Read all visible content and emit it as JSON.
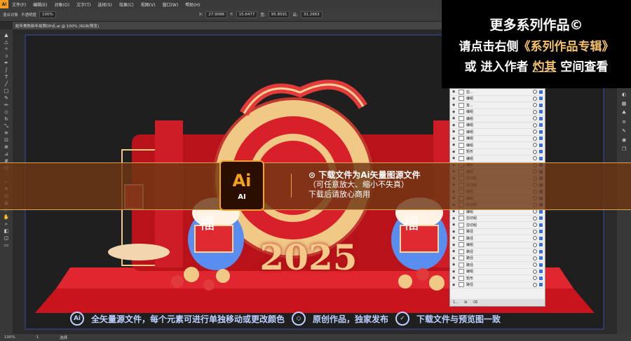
{
  "menubar": {
    "app_logo": "Ai",
    "items": [
      "文件(F)",
      "编辑(E)",
      "对象(O)",
      "文字(T)",
      "选择(S)",
      "效果(C)",
      "视图(V)",
      "窗口(W)",
      "帮助(H)"
    ]
  },
  "ctrlbar": {
    "selection": "混合对象",
    "opacity_label": "不透明度",
    "opacity_value": "100%",
    "x_label": "X:",
    "x_value": "27.9086",
    "y_label": "Y:",
    "y_value": "15.6477",
    "w_label": "宽:",
    "w_value": "95.8591",
    "h_label": "高:",
    "h_value": "31.2963"
  },
  "tab": {
    "title": "蛇年美陈新年拍照DP点.ai @ 100% (RGB/预览)"
  },
  "status": {
    "zoom": "100%",
    "page": "1",
    "tool": "选择"
  },
  "promo": {
    "line1": "更多系列作品©",
    "line2_prefix": "请点击右侧",
    "line2_hl": "《系列作品专辑》",
    "line3_prefix": "或  进入作者 ",
    "line3_hl": "灼其",
    "line3_suffix": " 空间查看"
  },
  "layers": {
    "rows": [
      "剪...",
      "编组",
      "复...",
      "编组",
      "编组",
      "编组",
      "编组",
      "编组",
      "编组",
      "矩形",
      "编组",
      "编组",
      "编组",
      "剪切组",
      "剪切组",
      "编组",
      "编组",
      "剪切组",
      "编组",
      "剪切组",
      "剪切组",
      "路径",
      "路径",
      "编组",
      "路径",
      "路径",
      "路径",
      "编组",
      "矩形",
      "路径"
    ],
    "footer": "1..."
  },
  "banner": {
    "badge_big": "Ai",
    "badge_small": "AI",
    "line1": "下载文件为Ai矢量图源文件",
    "line2": "（可任意放大、缩小不失真）",
    "line3": "下载后请放心商用"
  },
  "bottom": {
    "badge1": "Ai",
    "text1": "全矢量源文件，每个元素可进行单独移动或更改颜色",
    "text2": "原创作品，独家发布",
    "text3": "下载文件与预览图一致"
  },
  "artwork": {
    "number": "2025",
    "fu": "福"
  },
  "colors": {
    "accent": "#f7a21b",
    "artwork_red": "#d8202a",
    "artwork_gold": "#f2c17a"
  }
}
